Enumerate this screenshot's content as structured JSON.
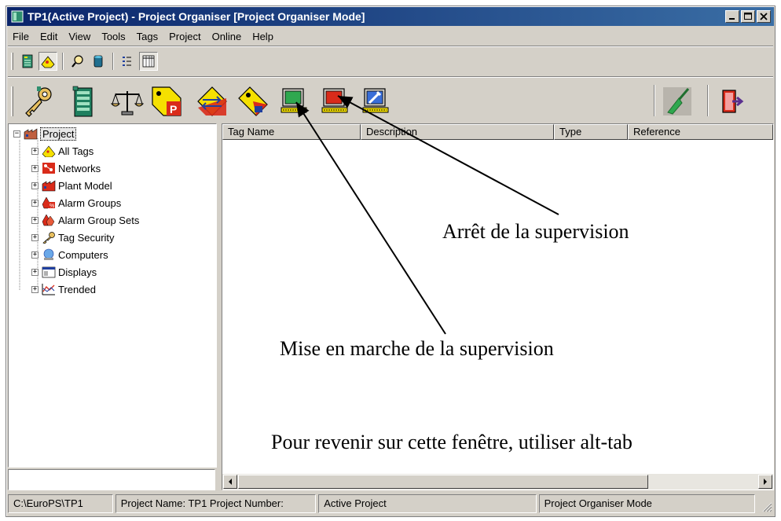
{
  "window": {
    "title": "TP1(Active Project) - Project Organiser [Project Organiser Mode]"
  },
  "menu": [
    {
      "label": "File"
    },
    {
      "label": "Edit"
    },
    {
      "label": "View"
    },
    {
      "label": "Tools"
    },
    {
      "label": "Tags"
    },
    {
      "label": "Project"
    },
    {
      "label": "Online"
    },
    {
      "label": "Help"
    }
  ],
  "tree": {
    "root": "Project",
    "items": [
      {
        "label": "All Tags",
        "icon": "all-tags-icon"
      },
      {
        "label": "Networks",
        "icon": "networks-icon"
      },
      {
        "label": "Plant Model",
        "icon": "plant-model-icon"
      },
      {
        "label": "Alarm Groups",
        "icon": "alarm-groups-icon"
      },
      {
        "label": "Alarm Group Sets",
        "icon": "alarm-group-sets-icon"
      },
      {
        "label": "Tag Security",
        "icon": "key-icon"
      },
      {
        "label": "Computers",
        "icon": "computers-icon"
      },
      {
        "label": "Displays",
        "icon": "displays-icon"
      },
      {
        "label": "Trended",
        "icon": "trend-icon"
      }
    ]
  },
  "list": {
    "columns": [
      "Tag Name",
      "Description",
      "Type",
      "Reference"
    ]
  },
  "status": {
    "path": "C:\\EuroPS\\TP1",
    "project": "Project Name: TP1 Project  Number:",
    "state": "Active Project",
    "mode": "Project Organiser Mode"
  },
  "annotations": {
    "stop": "Arrêt de la supervision",
    "start": "Mise en marche de la supervision",
    "alt_tab": "Pour revenir sur cette fenêtre, utiliser alt-tab"
  },
  "colors": {
    "titlebar": "#0a246a",
    "face": "#d4d0c8",
    "green_monitor": "#2fa84f",
    "red_monitor": "#d92b1a",
    "yellow": "#f5e000"
  }
}
